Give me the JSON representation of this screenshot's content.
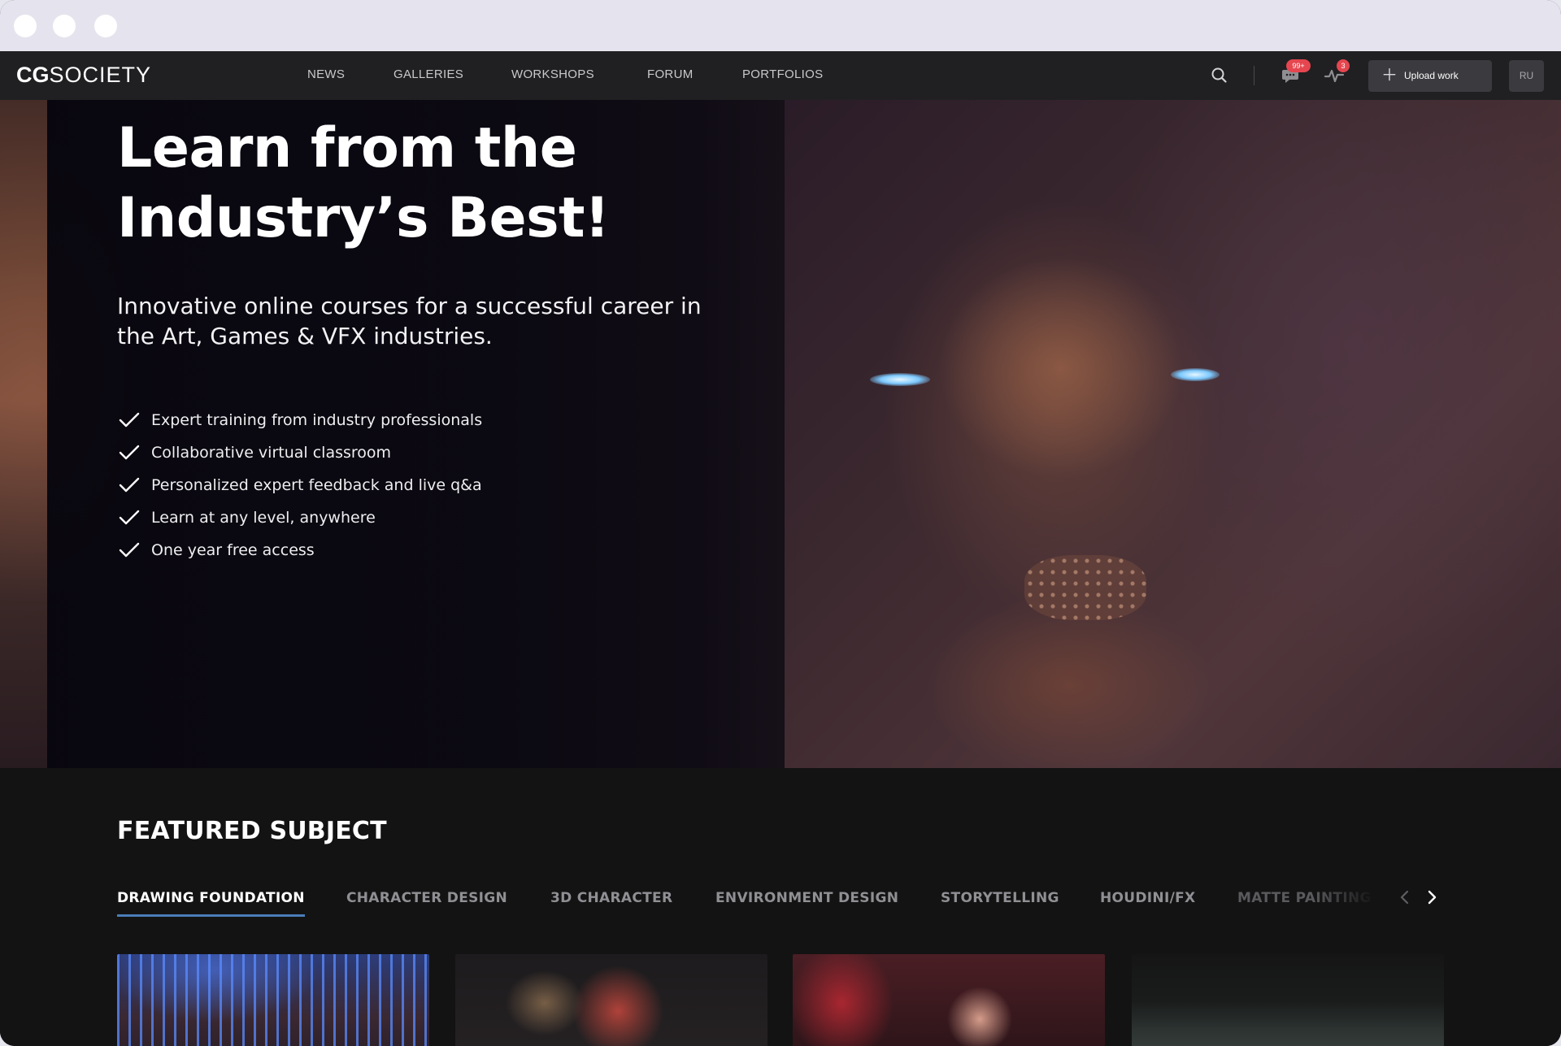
{
  "nav": {
    "logo_bold": "CG",
    "logo_rest": "SOCIETY",
    "items": [
      "NEWS",
      "GALLERIES",
      "WORKSHOPS",
      "FORUM",
      "PORTFOLIOS"
    ],
    "messages_badge": "99+",
    "activity_badge": "3",
    "upload_label": "Upload work",
    "avatar_initials": "RU"
  },
  "hero": {
    "title": "Learn from the Industry’s Best!",
    "subtitle": "Innovative online courses for a successful career in the Art, Games & VFX industries.",
    "features": [
      "Expert training from industry professionals",
      "Collaborative virtual classroom",
      "Personalized expert feedback and live q&a",
      "Learn at any level, anywhere",
      "One year free access"
    ]
  },
  "featured": {
    "title": "FEATURED SUBJECT",
    "tabs": [
      "DRAWING FOUNDATION",
      "CHARACTER DESIGN",
      "3D CHARACTER",
      "ENVIRONMENT DESIGN",
      "STORYTELLING",
      "HOUDINI/FX",
      "MATTE PAINTING"
    ],
    "active_tab": "DRAWING FOUNDATION"
  },
  "colors": {
    "nav_bg": "#202022",
    "page_bg": "#131313",
    "accent_underline": "#4a7db8",
    "badge": "#e5464f"
  },
  "icons": [
    "search-icon",
    "chat-bubble-icon",
    "activity-pulse-icon",
    "plus-icon",
    "check-icon",
    "chevron-left-icon",
    "chevron-right-icon"
  ]
}
